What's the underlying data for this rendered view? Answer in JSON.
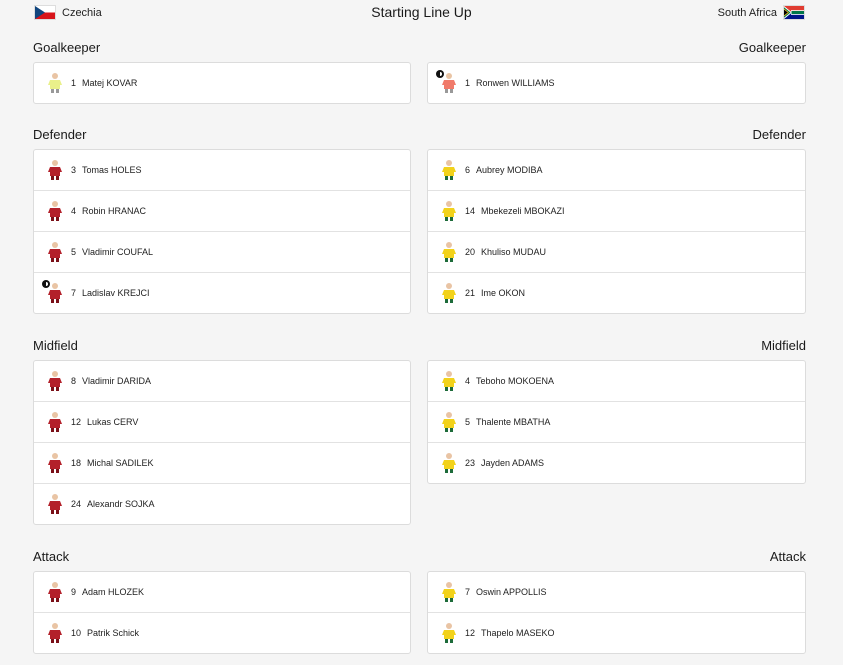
{
  "header": {
    "title": "Starting Line Up",
    "home_team": "Czechia",
    "away_team": "South Africa"
  },
  "colors": {
    "czech_kit": "#b3202a",
    "czech_gk_kit": "#e9f08a",
    "sa_kit": "#f2d21b",
    "sa_gk_kit": "#f07a6a",
    "captain_icon": "#111111"
  },
  "sections": [
    {
      "title": "Goalkeeper",
      "home": [
        {
          "number": "1",
          "name": "Matej KOVAR",
          "kit": "czech-gk",
          "captain": false
        }
      ],
      "away": [
        {
          "number": "1",
          "name": "Ronwen WILLIAMS",
          "kit": "sa-gk",
          "captain": true
        }
      ]
    },
    {
      "title": "Defender",
      "home": [
        {
          "number": "3",
          "name": "Tomas HOLES",
          "kit": "czech",
          "captain": false
        },
        {
          "number": "4",
          "name": "Robin HRANAC",
          "kit": "czech",
          "captain": false
        },
        {
          "number": "5",
          "name": "Vladimir COUFAL",
          "kit": "czech",
          "captain": false
        },
        {
          "number": "7",
          "name": "Ladislav KREJCI",
          "kit": "czech",
          "captain": true
        }
      ],
      "away": [
        {
          "number": "6",
          "name": "Aubrey MODIBA",
          "kit": "sa",
          "captain": false
        },
        {
          "number": "14",
          "name": "Mbekezeli MBOKAZI",
          "kit": "sa",
          "captain": false
        },
        {
          "number": "20",
          "name": "Khuliso MUDAU",
          "kit": "sa",
          "captain": false
        },
        {
          "number": "21",
          "name": "Ime OKON",
          "kit": "sa",
          "captain": false
        }
      ]
    },
    {
      "title": "Midfield",
      "home": [
        {
          "number": "8",
          "name": "Vladimir DARIDA",
          "kit": "czech",
          "captain": false
        },
        {
          "number": "12",
          "name": "Lukas CERV",
          "kit": "czech",
          "captain": false
        },
        {
          "number": "18",
          "name": "Michal SADILEK",
          "kit": "czech",
          "captain": false
        },
        {
          "number": "24",
          "name": "Alexandr SOJKA",
          "kit": "czech",
          "captain": false
        }
      ],
      "away": [
        {
          "number": "4",
          "name": "Teboho MOKOENA",
          "kit": "sa",
          "captain": false
        },
        {
          "number": "5",
          "name": "Thalente MBATHA",
          "kit": "sa",
          "captain": false
        },
        {
          "number": "23",
          "name": "Jayden ADAMS",
          "kit": "sa",
          "captain": false
        }
      ]
    },
    {
      "title": "Attack",
      "home": [
        {
          "number": "9",
          "name": "Adam HLOZEK",
          "kit": "czech",
          "captain": false
        },
        {
          "number": "10",
          "name": "Patrik Schick",
          "kit": "czech",
          "captain": false
        }
      ],
      "away": [
        {
          "number": "7",
          "name": "Oswin APPOLLIS",
          "kit": "sa",
          "captain": false
        },
        {
          "number": "12",
          "name": "Thapelo MASEKO",
          "kit": "sa",
          "captain": false
        }
      ]
    }
  ]
}
